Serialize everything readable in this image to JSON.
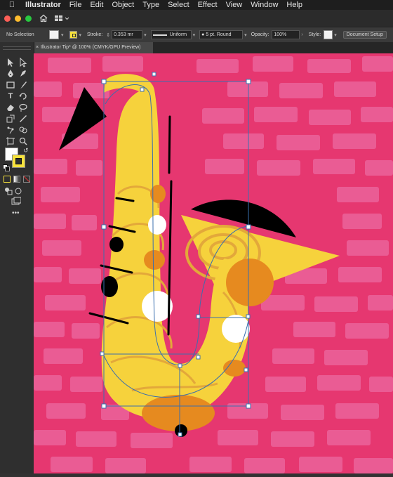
{
  "menubar": {
    "app_name": "Illustrator",
    "menus": [
      "File",
      "Edit",
      "Object",
      "Type",
      "Select",
      "Effect",
      "View",
      "Window",
      "Help"
    ]
  },
  "control_bar": {
    "selection_label": "No Selection",
    "stroke_label": "Stroke:",
    "stroke_weight": "0.353 mr",
    "stroke_profile": "Uniform",
    "brush": "5 pt. Round",
    "opacity_label": "Opacity:",
    "opacity_value": "100%",
    "style_label": "Style:",
    "document_setup_label": "Document Setup"
  },
  "document_tab": {
    "title": "Illustrator Tip* @ 100% (CMYK/GPU Preview)"
  },
  "tools": [
    "selection-tool",
    "direct-selection-tool",
    "pen-tool",
    "curvature-tool",
    "rectangle-tool",
    "paintbrush-tool",
    "type-tool",
    "rotate-tool",
    "eraser-tool",
    "lasso-tool",
    "scale-tool",
    "eyedropper-tool",
    "puppet-warp-tool",
    "shape-builder-tool",
    "artboard-tool",
    "zoom-tool"
  ],
  "colors": {
    "canvas_bg": "#e63770",
    "brick": "#ea5c94",
    "sax_body": "#f6d23c",
    "sax_grain": "#e3a83a",
    "accent_orange": "#e68a1f",
    "selection_blue": "#3a6fae",
    "fill_swatch": "#ffffff",
    "stroke_swatch": "#f7e23c"
  }
}
